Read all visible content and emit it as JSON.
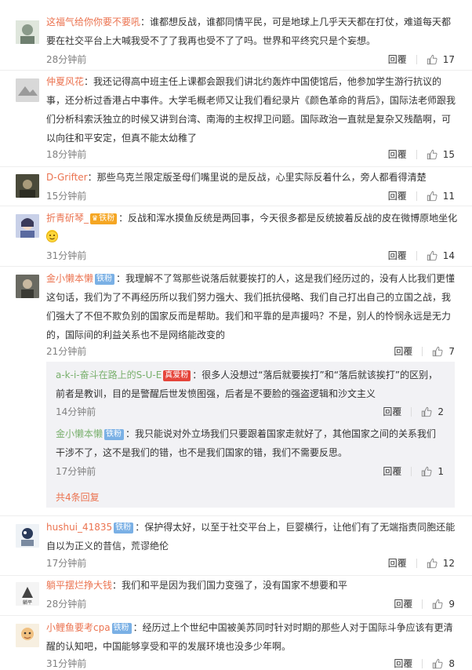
{
  "comments": [
    {
      "username": "这福气给你你要不要吼",
      "text": "：谁都想反战，谁都同情平民，可是地球上几乎天天都在打仗，难道每天都要在社交平台上大喊我受不了了我再也受不了了吗。世界和平终究只是个妄想。",
      "time": "28分钟前",
      "reply": "回覆",
      "likes": "17"
    },
    {
      "username": "仲夏风花",
      "text": "：我还记得高中班主任上课都会跟我们讲北约轰炸中国使馆后，他参加学生游行抗议的事，还分析过香港占中事件。大学毛概老师又让我们看纪录片《颜色革命的背后》，国际法老师跟我们分析科索沃独立的时候又讲到台湾、南海的主权捍卫问题。国际政治一直就是复杂又残酷啊，可以向往和平安定，但真不能太幼稚了",
      "time": "18分钟前",
      "reply": "回覆",
      "likes": "15"
    },
    {
      "username": "D-Grifter",
      "text": "：那些乌克兰限定版圣母们嘴里说的是反战，心里实际反着什么，旁人都看得清楚",
      "time": "15分钟前",
      "reply": "回覆",
      "likes": "11"
    },
    {
      "username": "折青斫琴_",
      "badge": "铁粉",
      "text": "：反战和浑水摸鱼反统是两回事，今天很多都是反统披着反战的皮在微博原地坐化",
      "time": "31分钟前",
      "reply": "回覆",
      "likes": "14"
    },
    {
      "username": "金小懒本懒",
      "badge": "铁粉",
      "text": "：我理解不了驾那些说落后就要挨打的人，这是我们经历过的，没有人比我们更懂这句话，我们为了不再经历所以我们努力强大、我们抵抗侵略、我们自己打出自己的立国之战，我们强大了不但不欺负别的国家反而是帮助。我们和平靠的是声援吗？不是，别人的怜悯永远是无力的，国际间的利益关系也不是网络能改变的",
      "time": "21分钟前",
      "reply": "回覆",
      "likes": "7",
      "replies": [
        {
          "username": "a-k-i-奋斗在路上的S-U-E",
          "badge": "真爱粉",
          "text": "：很多人没想过“落后就要挨打”和“落后就该挨打”的区别，前者是教训，目的是警醒后世发愤图强，后者是不要脸的强盗逻辑和沙文主义",
          "time": "14分钟前",
          "reply": "回覆",
          "likes": "2"
        },
        {
          "username": "金小懒本懒",
          "badge": "铁粉",
          "text": "：我只能说对外立场我们只要跟着国家走就好了，其他国家之间的关系我们干涉不了，这不是我们的错，也不是我们国家的错，我们不需要反思。",
          "time": "17分钟前",
          "reply": "回覆",
          "likes": "1"
        }
      ],
      "reply_count": "共4条回复"
    },
    {
      "username": "hushui_41835",
      "badge": "铁粉",
      "text": "：保护得太好，以至于社交平台上，巨婴横行，让他们有了无端指责同胞还能自以为正义的昔信，荒谬绝伦",
      "time": "17分钟前",
      "reply": "回覆",
      "likes": "12"
    },
    {
      "username": "躺平摆烂挣大钱",
      "text": "：我们和平是因为我们国力变强了，没有国家不想要和平",
      "time": "28分钟前",
      "reply": "回覆",
      "likes": "9"
    },
    {
      "username": "小鲤鱼要考cpa",
      "badge": "铁粉",
      "text": "：经历过上个世纪中国被美苏同时针对时期的那些人对于国际斗争应该有更清醒的认知吧，中国能够享受和平的发展环境也没多少年啊。",
      "time": "31分钟前",
      "reply": "回覆",
      "likes": "8"
    }
  ]
}
